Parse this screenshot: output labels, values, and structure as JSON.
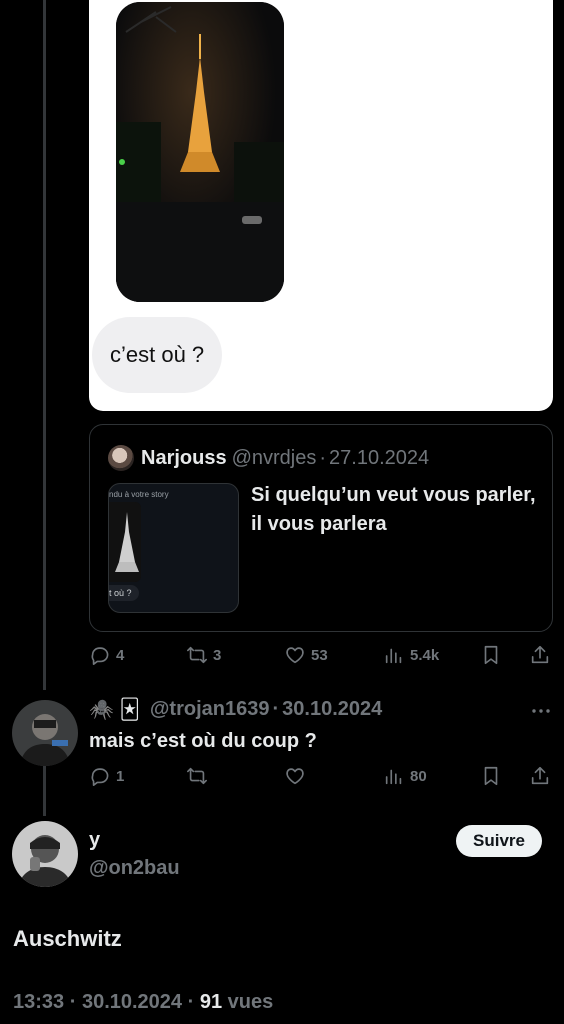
{
  "dm": {
    "message": "c’est où ?"
  },
  "quote": {
    "name": "Narjouss",
    "handle": "@nvrdjes",
    "date": "27.10.2024",
    "text": "Si quelqu’un veut vous parler, il vous parlera",
    "thumb_caption": "ndu à votre story",
    "thumb_bubble": "t où ?"
  },
  "quote_actions": {
    "replies": "4",
    "retweets": "3",
    "likes": "53",
    "views": "5.4k"
  },
  "reply": {
    "emojis": "🕷️ 🃏",
    "handle": "@trojan1639",
    "date": "30.10.2024",
    "text": "mais c’est où du coup ?",
    "replies": "1",
    "views": "80"
  },
  "main": {
    "name": "y",
    "handle": "@on2bau",
    "follow_label": "Suivre",
    "text": "Auschwitz",
    "time": "13:33",
    "date": "30.10.2024",
    "views_count": "91",
    "views_label": "vues"
  },
  "colors": {
    "background": "#000000",
    "text_primary": "#e7e9ea",
    "text_secondary": "#71767b",
    "border": "#2f3336"
  }
}
